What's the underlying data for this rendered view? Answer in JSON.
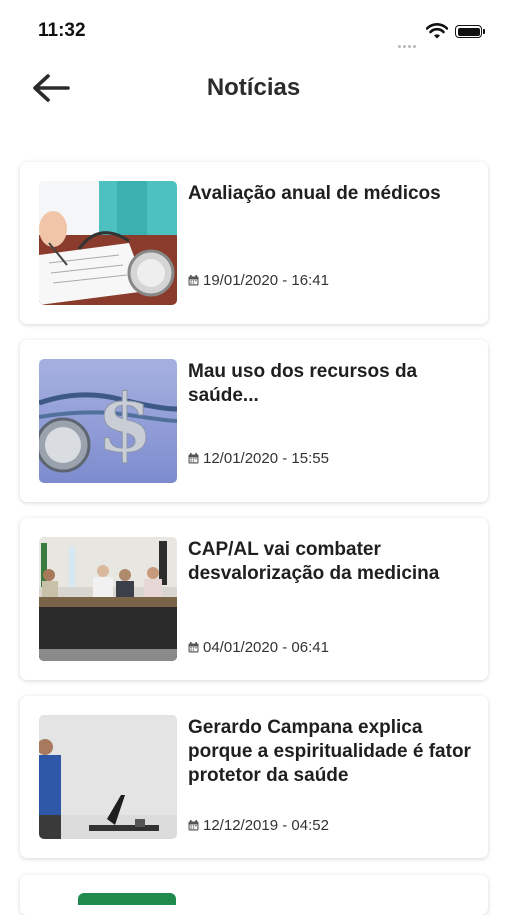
{
  "status_bar": {
    "time": "11:32"
  },
  "header": {
    "title": "Notícias"
  },
  "news": [
    {
      "title": "Avaliação anual de médicos",
      "date": "19/01/2020 - 16:41"
    },
    {
      "title": "Mau uso dos recursos da saúde...",
      "date": "12/01/2020 - 15:55"
    },
    {
      "title": "CAP/AL vai combater desvalorização da medicina",
      "date": "04/01/2020 - 06:41"
    },
    {
      "title": "Gerardo Campana explica porque a espiritualidade é fator protetor da saúde",
      "date": "12/12/2019 - 04:52"
    }
  ],
  "icons": {
    "back": "arrow-left-icon",
    "calendar": "calendar-icon",
    "wifi": "wifi-icon",
    "battery": "battery-icon",
    "signal": "signal-icon"
  }
}
